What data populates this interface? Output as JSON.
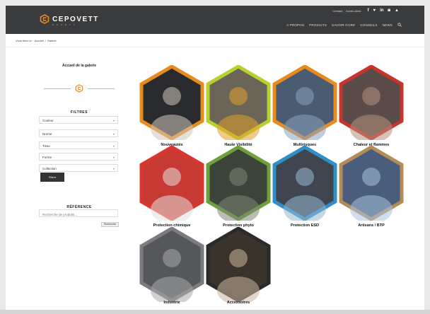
{
  "header": {
    "logo_text": "CEPOVETT",
    "logo_sub": "SAFETY",
    "top_links": [
      "Contact",
      "Accès client"
    ],
    "social": [
      "f",
      "t",
      "in",
      "ig",
      "yt"
    ],
    "nav": [
      "A PROPOS",
      "PRODUITS",
      "SAVOIR FAIRE",
      "CONSEILS",
      "NEWS"
    ]
  },
  "breadcrumb": {
    "prefix": "Vous êtes ici :",
    "home": "Accueil",
    "sep": "/",
    "current": "Galerie"
  },
  "sidebar": {
    "gallery_home": "Accueil de la galerie",
    "filters_title": "FILTRES",
    "selects": [
      {
        "label": "Couleur"
      },
      {
        "label": "Norme"
      },
      {
        "label": "Tissu"
      },
      {
        "label": "Forme"
      },
      {
        "label": "Collection"
      }
    ],
    "filter_button": "Filtrer",
    "reference_title": "RÉFÉRENCE",
    "search_placeholder": "Recherche de produits...",
    "search_button": "Recherche"
  },
  "gallery": [
    {
      "label": "Nouveautés",
      "border": "#e78b1e",
      "fill": "#2a2b2e",
      "accent": "#cfc6ba"
    },
    {
      "label": "Haute Visibilité",
      "border": "#b9d12e",
      "fill": "#6b6458",
      "accent": "#e2a12b"
    },
    {
      "label": "Multirisques",
      "border": "#e78b1e",
      "fill": "#4b5b71",
      "accent": "#8aa3bd"
    },
    {
      "label": "Chaleur et flammes",
      "border": "#c8332b",
      "fill": "#5a4c48",
      "accent": "#b78f7d"
    },
    {
      "label": "Protection chimique",
      "border": "#d9372d",
      "fill": "#c63a33",
      "accent": "#e3e0dc"
    },
    {
      "label": "Protection phyto",
      "border": "#6ea13b",
      "fill": "#3c4439",
      "accent": "#7d8875"
    },
    {
      "label": "Protection ESD",
      "border": "#2f8fc6",
      "fill": "#404650",
      "accent": "#96b8d1"
    },
    {
      "label": "Artisans / BTP",
      "border": "#b48c57",
      "fill": "#4a5d7c",
      "accent": "#a9c3df"
    },
    {
      "label": "Industrie",
      "border": "#7a7c80",
      "fill": "#55575b",
      "accent": "#a9a9a9"
    },
    {
      "label": "Accessoires",
      "border": "#2a2a2a",
      "fill": "#3a332c",
      "accent": "#c9b49c"
    }
  ]
}
